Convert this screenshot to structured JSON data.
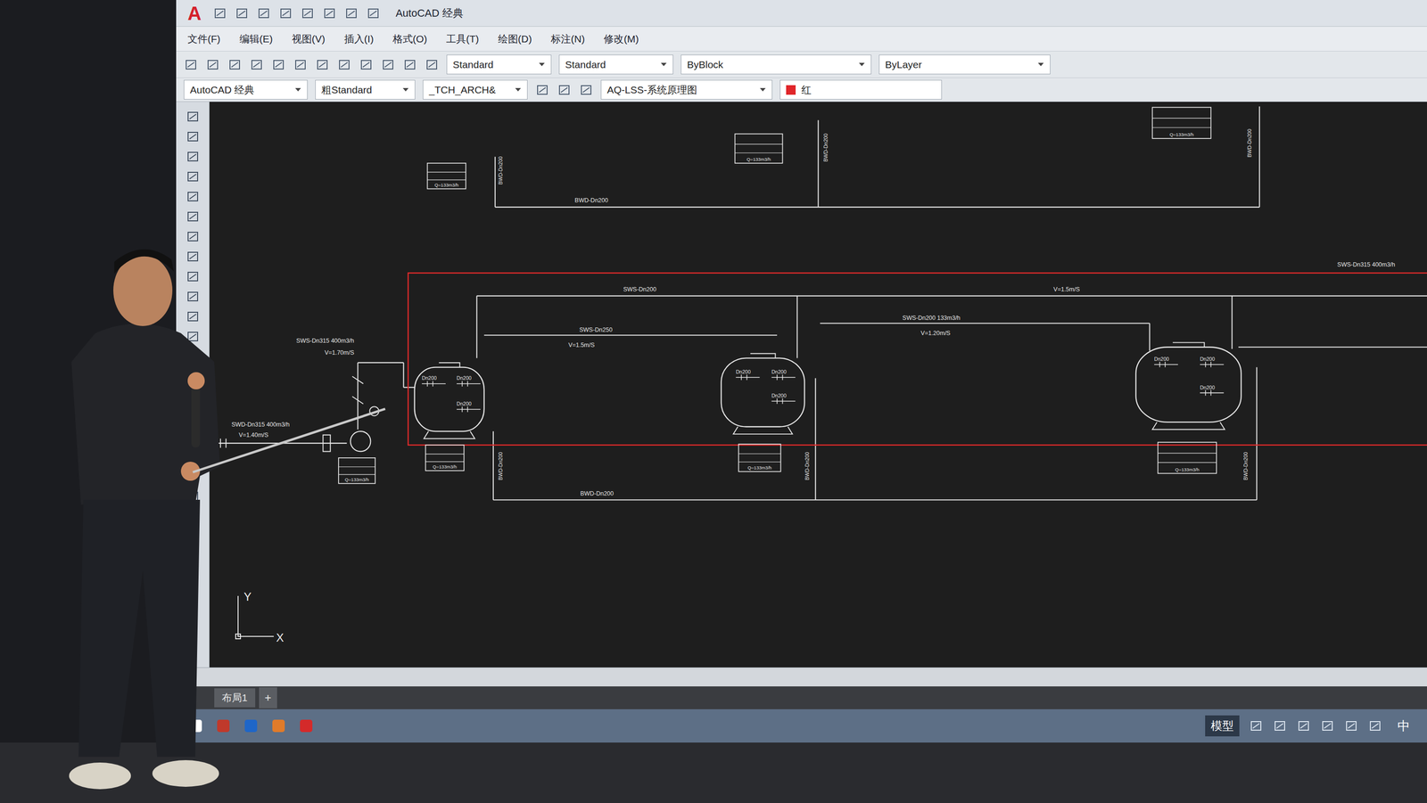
{
  "window": {
    "title": "AutoCAD 经典",
    "logo": "A"
  },
  "menu": [
    "文件(F)",
    "编辑(E)",
    "视图(V)",
    "插入(I)",
    "格式(O)",
    "工具(T)",
    "绘图(D)",
    "标注(N)",
    "修改(M)"
  ],
  "toolbar": {
    "text_style": "Standard",
    "dim_style": "Standard",
    "linetype": "ByBlock",
    "lineweight": "ByLayer"
  },
  "properties": {
    "workspace": "AutoCAD 经典",
    "style": "粗Standard",
    "layer_state": "_TCH_ARCH&",
    "layer": "AQ-LSS-系统原理图",
    "color": "红"
  },
  "drawing": {
    "labels": [
      {
        "text": "SWS-Dn315 400m3/h"
      },
      {
        "text": "SWS-Dn200"
      },
      {
        "text": "V=1.5m/S"
      },
      {
        "text": "SWS-Dn250"
      },
      {
        "text": "V=1.5m/S"
      },
      {
        "text": "SWS-Dn200 133m3/h"
      },
      {
        "text": "V=1.20m/S"
      },
      {
        "text": "BWD-Dn200"
      },
      {
        "text": "BWD-Dn200"
      },
      {
        "text": "SWS-Dn315 400m3/h"
      },
      {
        "text": "V=1.70m/S"
      },
      {
        "text": "SWD-Dn315 400m3/h"
      },
      {
        "text": "V=1.40m/S"
      }
    ],
    "vertical_labels": [
      "BWD-Dn200",
      "BWD-Dn200",
      "BWD-Dn200",
      "BWD-Dn200",
      "BWD-Dn200",
      "BWD-Dn200"
    ],
    "tanks": [
      {
        "valves": [
          "Dn200",
          "Dn200",
          "Dn200"
        ]
      },
      {
        "valves": [
          "Dn200",
          "Dn200",
          "Dn200"
        ]
      },
      {
        "valves": [
          "Dn200",
          "Dn200",
          "Dn200"
        ]
      }
    ],
    "tags": [
      "Q=133m3/h",
      "Q=133m3/h",
      "Q=133m3/h",
      "Q=133m3/h",
      "Q=133m3/h",
      "Q=133m3/h",
      "Q=133m3/h"
    ]
  },
  "axis": {
    "x": "X",
    "y": "Y"
  },
  "tabs": [
    {
      "label": "布局1",
      "selected": false
    }
  ],
  "new_tab": "+",
  "status_bar": {
    "mode": "模型"
  },
  "taskbar": {
    "ime": "中"
  }
}
